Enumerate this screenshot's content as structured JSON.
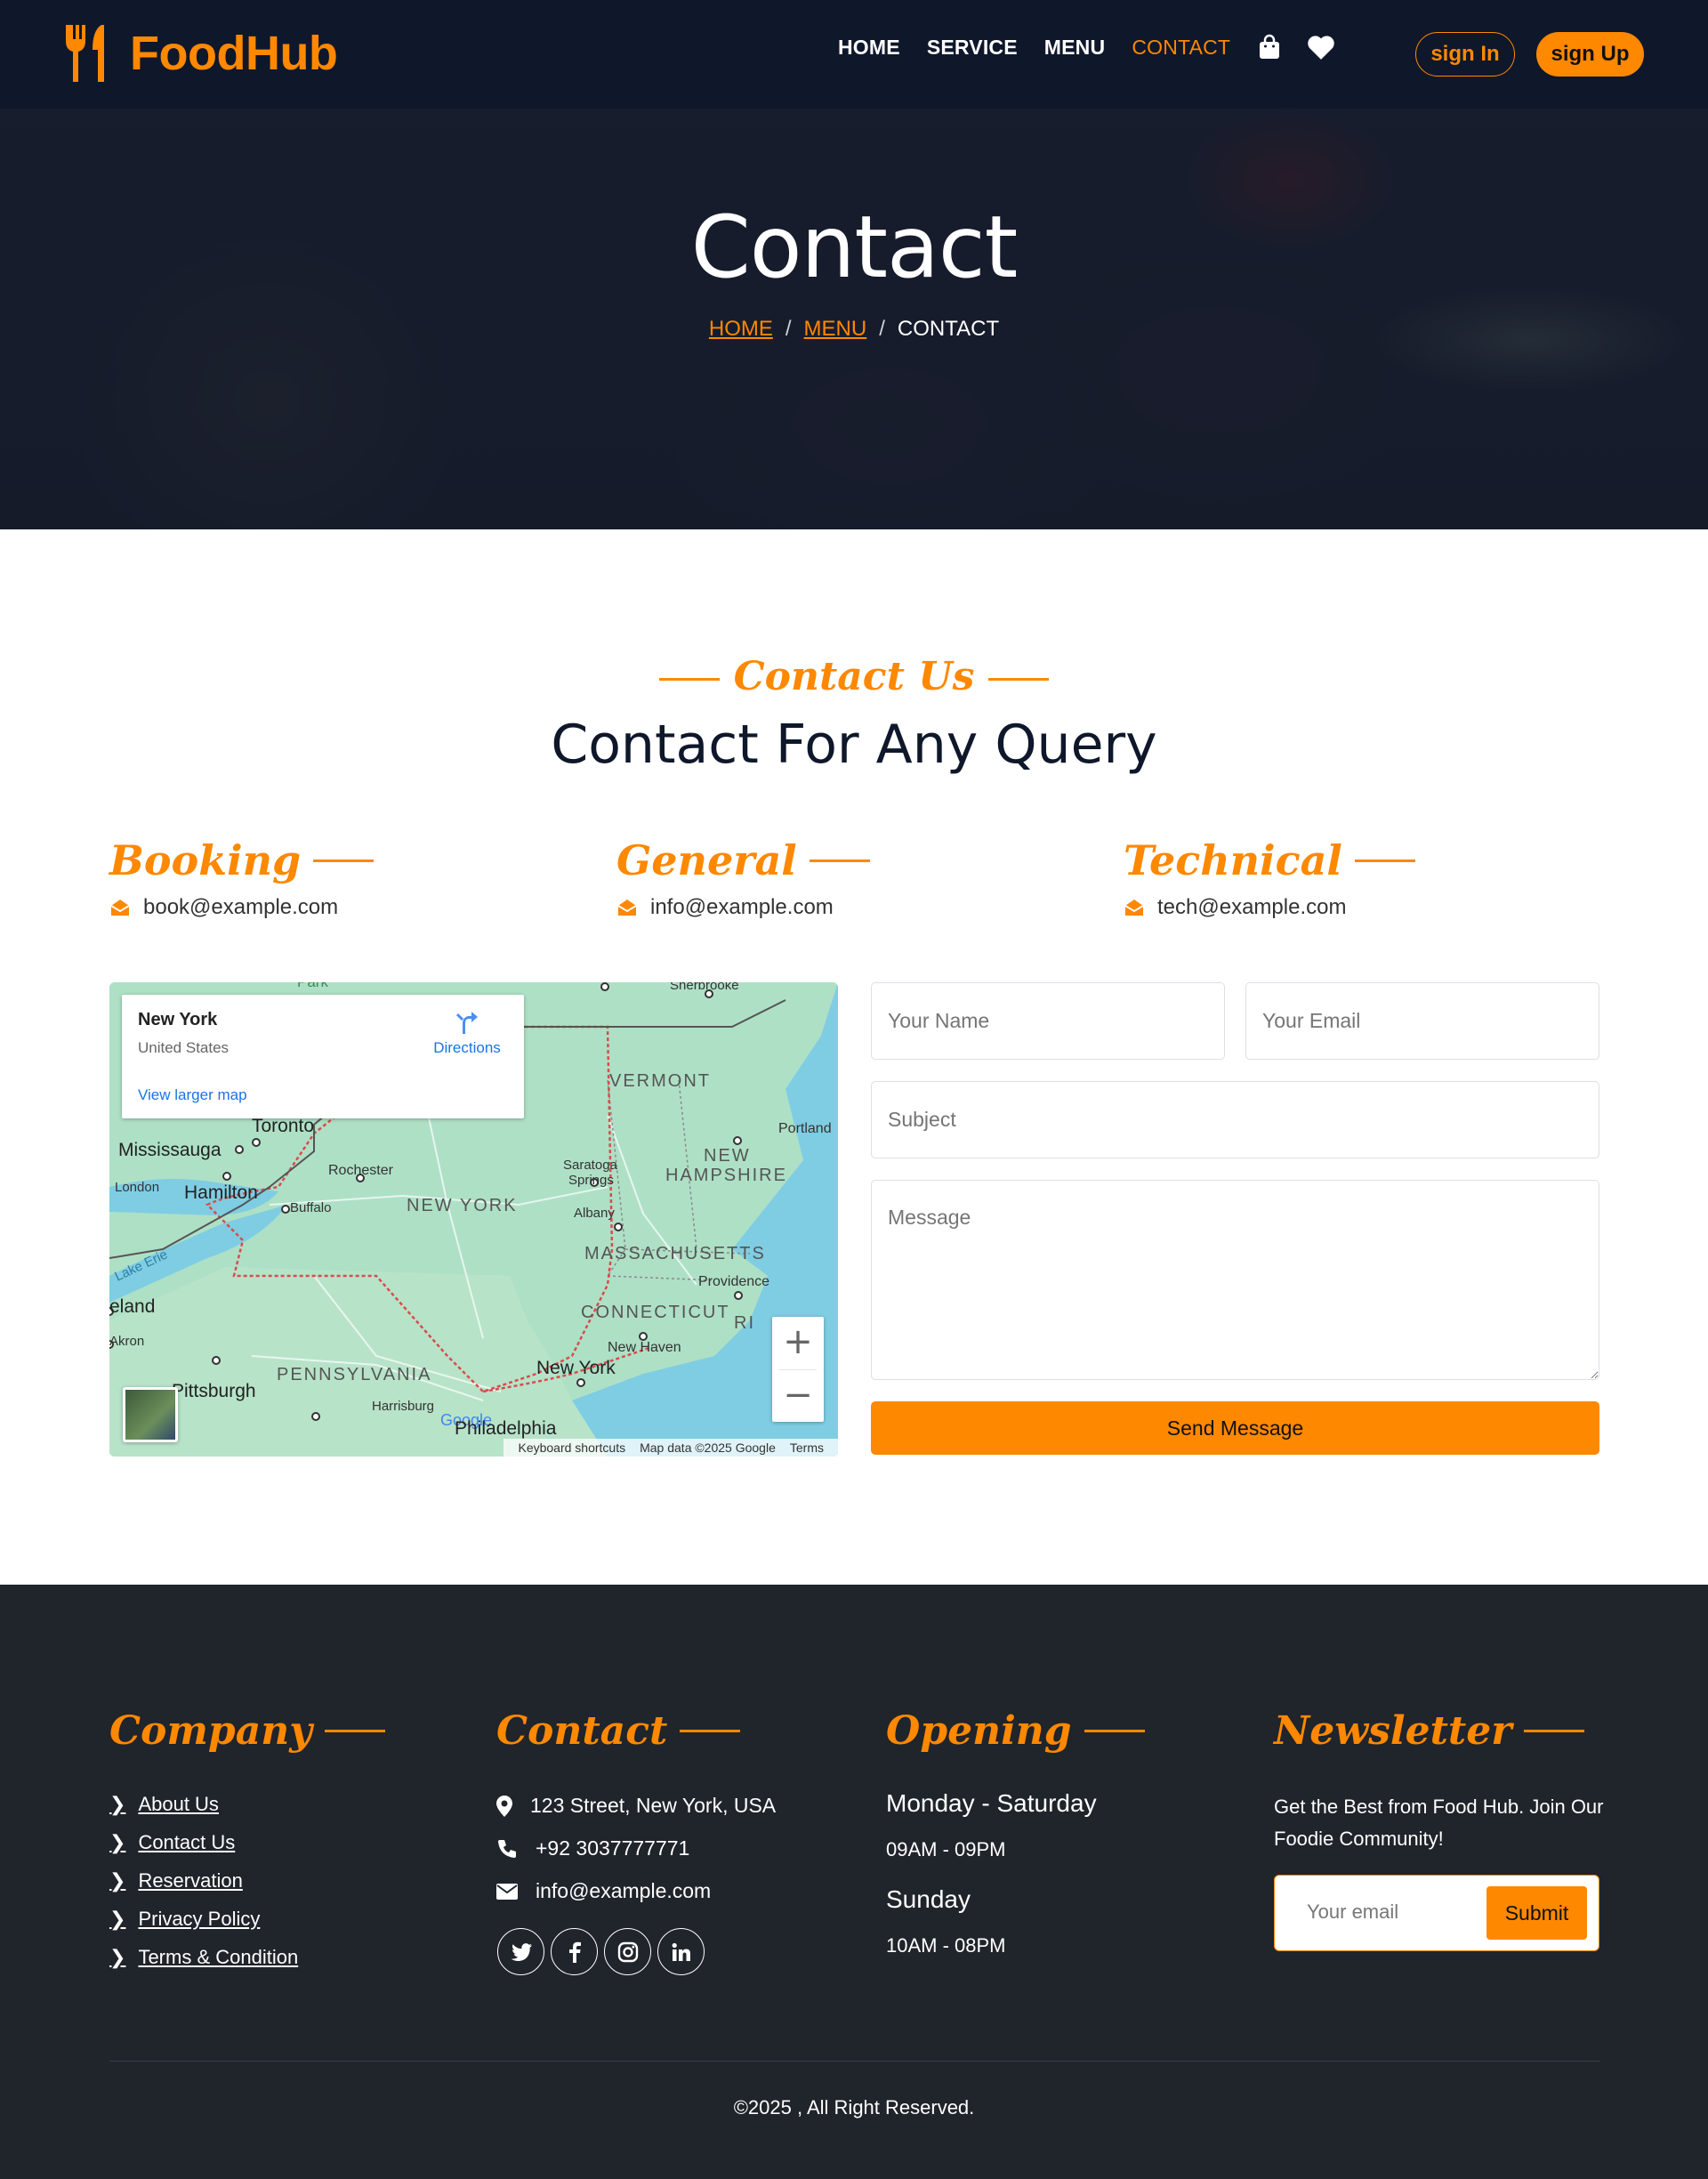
{
  "brand": {
    "name": "FoodHub"
  },
  "nav": {
    "links": [
      "HOME",
      "SERVICE",
      "MENU",
      "CONTACT"
    ],
    "signin": "sign In",
    "signup": "sign Up"
  },
  "hero": {
    "title": "Contact",
    "breadcrumb": [
      "HOME",
      "MENU",
      "CONTACT"
    ],
    "separator": "/"
  },
  "section": {
    "subtitle": "Contact Us",
    "title": "Contact For Any Query"
  },
  "contacts": [
    {
      "heading": "Booking",
      "email": "book@example.com"
    },
    {
      "heading": "General",
      "email": "info@example.com"
    },
    {
      "heading": "Technical",
      "email": "tech@example.com"
    }
  ],
  "map": {
    "place": "New York",
    "country": "United States",
    "directions": "Directions",
    "larger": "View larger map",
    "footer": [
      "Keyboard shortcuts",
      "Map data ©2025 Google",
      "Terms"
    ],
    "zoom_in": "+",
    "zoom_out": "−",
    "labels": {
      "park": "Park",
      "sherbrooke": "Sherbrooke",
      "vermont": "VERMONT",
      "portland": "Portland",
      "toronto": "Toronto",
      "mississauga": "Mississauga",
      "rochester": "Rochester",
      "saratoga": "Saratoga",
      "springs": "Springs",
      "new": "NEW",
      "hampshire": "HAMPSHIRE",
      "london": "London",
      "hamilton": "Hamilton",
      "buffalo": "Buffalo",
      "new_york_state": "NEW YORK",
      "albany": "Albany",
      "massachusetts": "MASSACHUSETTS",
      "providence": "Providence",
      "lake_erie": "Lake Erie",
      "eland": "eland",
      "connecticut": "CONNECTICUT",
      "ri": "RI",
      "akron": "Akron",
      "new_haven": "New Haven",
      "pittsburgh": "Pittsburgh",
      "pennsylvania": "PENNSYLVANIA",
      "new_york_city": "New York",
      "harrisburg": "Harrisburg",
      "google": "Google",
      "philadelphia": "Philadelphia"
    }
  },
  "form": {
    "name_placeholder": "Your Name",
    "email_placeholder": "Your Email",
    "subject_placeholder": "Subject",
    "message_placeholder": "Message",
    "submit": "Send Message"
  },
  "footer": {
    "company": {
      "heading": "Company",
      "links": [
        "About Us",
        "Contact Us",
        "Reservation",
        "Privacy Policy",
        "Terms & Condition"
      ]
    },
    "contact": {
      "heading": "Contact",
      "address": "123 Street, New York, USA",
      "phone": "+92 3037777771",
      "email": "info@example.com"
    },
    "opening": {
      "heading": "Opening",
      "weekday": "Monday - Saturday",
      "weekday_hours": "09AM - 09PM",
      "sunday": "Sunday",
      "sunday_hours": "10AM - 08PM"
    },
    "newsletter": {
      "heading": "Newsletter",
      "text": "Get the Best from Food Hub. Join Our Foodie Community!",
      "placeholder": "Your email",
      "button": "Submit"
    },
    "copyright": "©2025 , All Right Reserved."
  },
  "colors": {
    "accent": "#fe8800",
    "navy": "#0f172b",
    "footer": "#20242b"
  }
}
